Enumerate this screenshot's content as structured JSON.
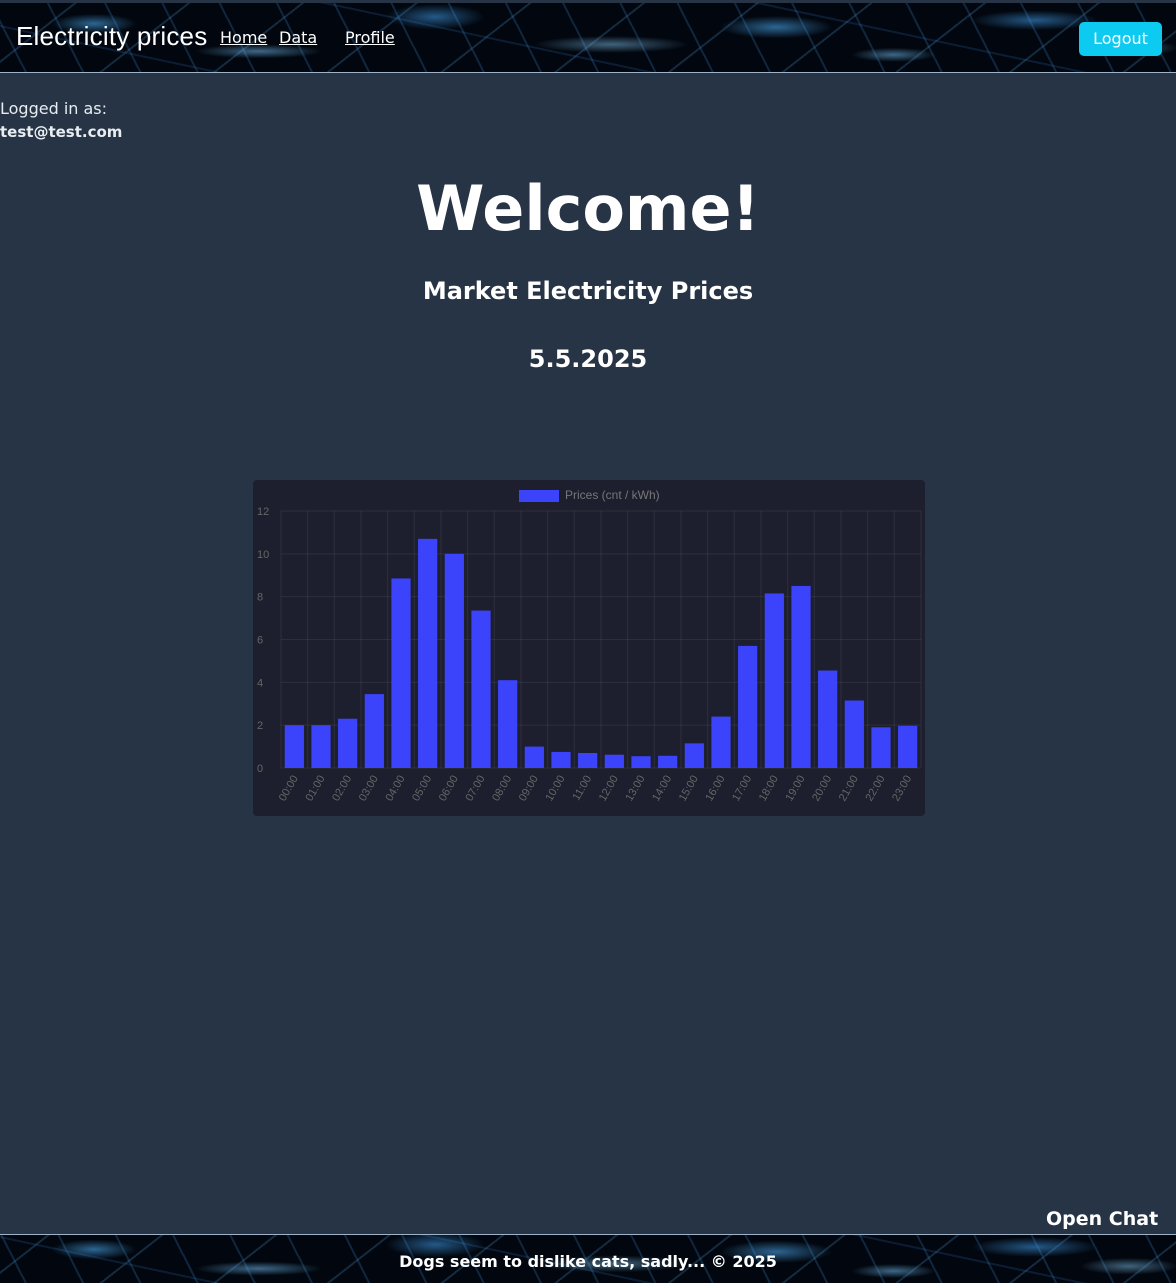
{
  "navbar": {
    "brand": "Electricity prices",
    "links": [
      "Home",
      "Data",
      "Profile"
    ],
    "logout_label": "Logout"
  },
  "user": {
    "logged_in_label": "Logged in as:",
    "email": "test@test.com"
  },
  "main": {
    "heading": "Welcome!",
    "subheading": "Market Electricity Prices",
    "date": "5.5.2025"
  },
  "chat": {
    "open_label": "Open Chat"
  },
  "footer": {
    "text": "Dogs seem to dislike cats, sadly... © 2025"
  },
  "colors": {
    "bar": "#3b44fb",
    "page_bg": "#273445",
    "chart_bg": "#1e1f2e",
    "logout_button": "#0dcaf0"
  },
  "chart_data": {
    "type": "bar",
    "categories": [
      "00:00",
      "01:00",
      "02:00",
      "03:00",
      "04:00",
      "05:00",
      "06:00",
      "07:00",
      "08:00",
      "09:00",
      "10:00",
      "11:00",
      "12:00",
      "13:00",
      "14:00",
      "15:00",
      "16:00",
      "17:00",
      "18:00",
      "19:00",
      "20:00",
      "21:00",
      "22:00",
      "23:00"
    ],
    "series": [
      {
        "name": "Prices (cnt / kWh)",
        "values": [
          2.0,
          2.0,
          2.3,
          3.45,
          8.85,
          10.7,
          10.0,
          7.35,
          4.1,
          1.0,
          0.75,
          0.7,
          0.62,
          0.55,
          0.57,
          1.15,
          2.4,
          5.7,
          8.15,
          8.5,
          4.55,
          3.15,
          1.9,
          1.97
        ]
      }
    ],
    "yticks": [
      "0",
      "2",
      "4",
      "6",
      "8",
      "10",
      "12"
    ],
    "ylim": [
      0,
      12
    ],
    "grid": true,
    "legend": "top-center"
  }
}
